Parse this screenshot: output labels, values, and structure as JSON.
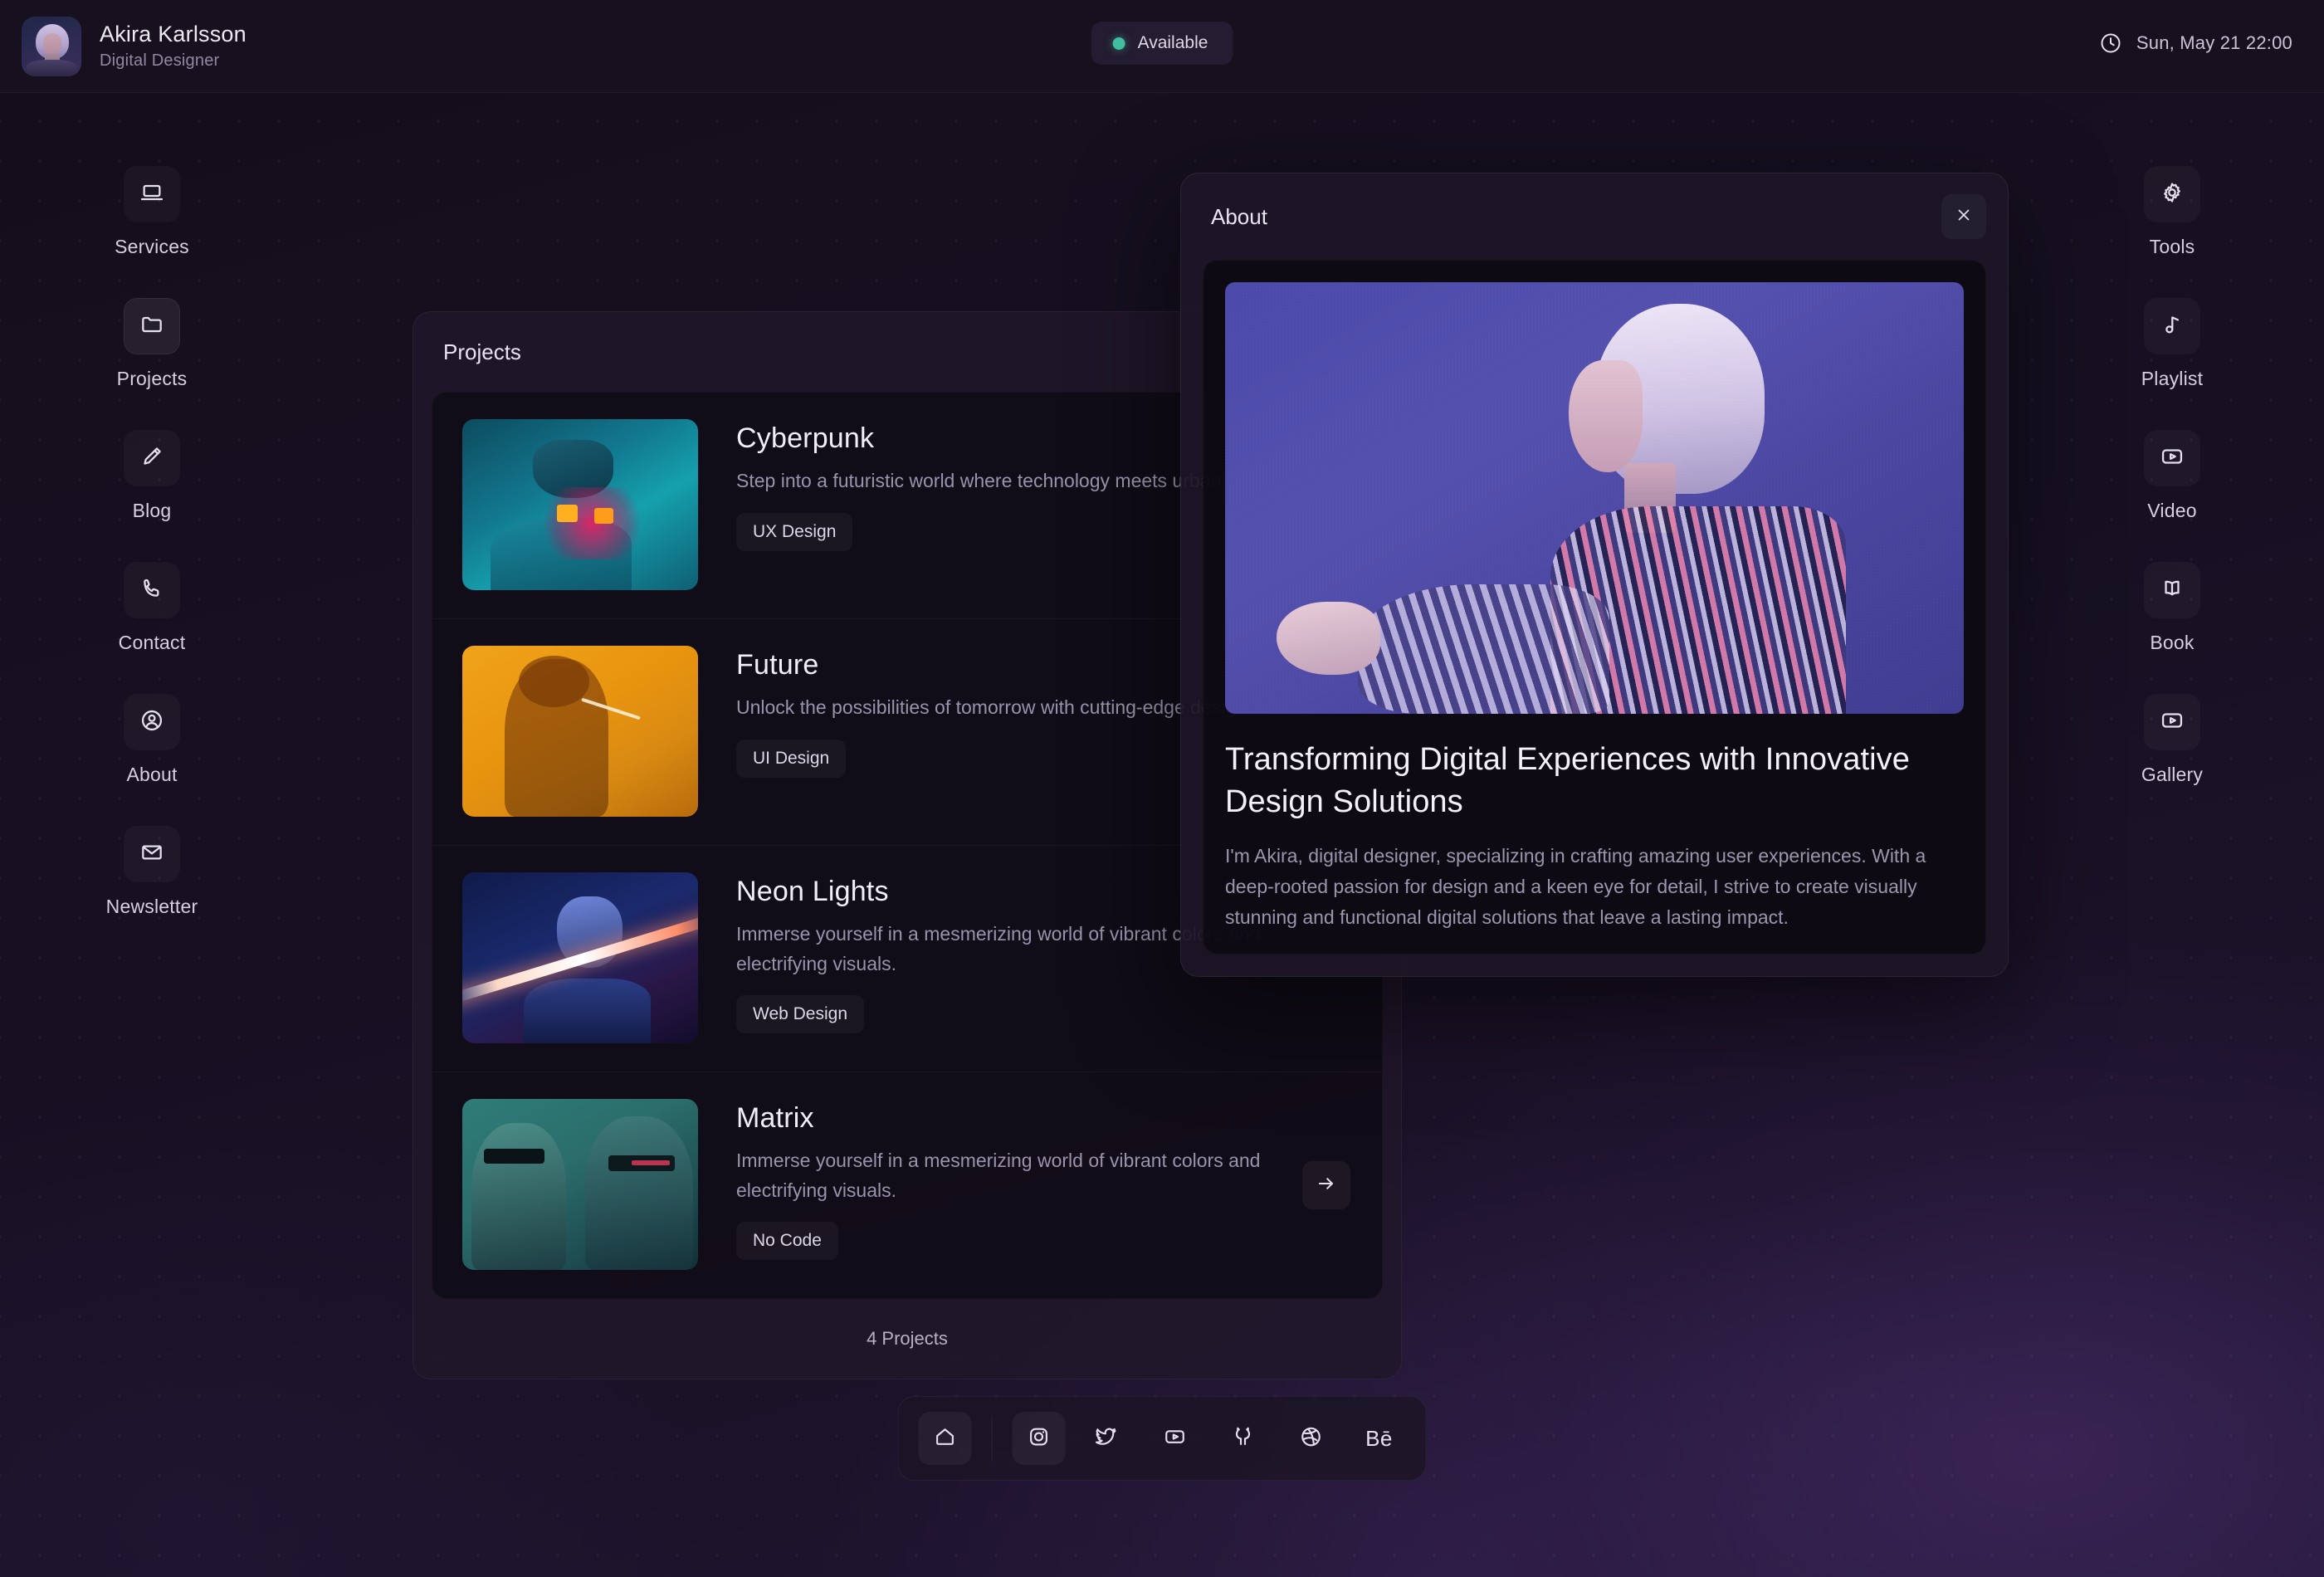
{
  "header": {
    "name": "Akira Karlsson",
    "role": "Digital Designer",
    "avatar_icon": "user-avatar-image",
    "status": {
      "label": "Available",
      "dot_color": "#3fbfa0"
    },
    "clock": {
      "icon": "clock-icon",
      "text": "Sun, May 21 22:00"
    }
  },
  "rail_left": {
    "items": [
      {
        "label": "Services",
        "icon": "laptop-icon",
        "active": false
      },
      {
        "label": "Projects",
        "icon": "folder-icon",
        "active": true
      },
      {
        "label": "Blog",
        "icon": "pencil-icon",
        "active": false
      },
      {
        "label": "Contact",
        "icon": "phone-icon",
        "active": false
      },
      {
        "label": "About",
        "icon": "user-circle-icon",
        "active": false
      },
      {
        "label": "Newsletter",
        "icon": "envelope-icon",
        "active": false
      }
    ]
  },
  "rail_right": {
    "items": [
      {
        "label": "Tools",
        "icon": "gear-icon",
        "active": false
      },
      {
        "label": "Playlist",
        "icon": "music-note-icon",
        "active": false
      },
      {
        "label": "Video",
        "icon": "video-play-icon",
        "active": false
      },
      {
        "label": "Book",
        "icon": "open-book-icon",
        "active": false
      },
      {
        "label": "Gallery",
        "icon": "video-play-icon",
        "active": false
      }
    ]
  },
  "projects_panel": {
    "title": "Projects",
    "footer": "4 Projects",
    "items": [
      {
        "title": "Cyberpunk",
        "description": "Step into a futuristic world where technology meets urban grit.",
        "tag": "UX Design",
        "thumb": "cyberpunk-thumbnail"
      },
      {
        "title": "Future",
        "description": "Unlock the possibilities of tomorrow with cutting-edge design.",
        "tag": "UI Design",
        "thumb": "future-thumbnail"
      },
      {
        "title": "Neon Lights",
        "description": "Immerse yourself in a mesmerizing world of vibrant colors and electrifying visuals.",
        "tag": "Web Design",
        "thumb": "neon-lights-thumbnail"
      },
      {
        "title": "Matrix",
        "description": "Immerse yourself in a mesmerizing world of vibrant colors and electrifying visuals.",
        "tag": "No Code",
        "thumb": "matrix-thumbnail",
        "arrow_icon": "arrow-right-icon"
      }
    ]
  },
  "about_modal": {
    "title": "About",
    "close_icon": "close-icon",
    "image": "akira-portrait-image",
    "heading": "Transforming Digital Experiences with Innovative Design Solutions",
    "body": "I'm Akira, digital designer, specializing in crafting amazing user experiences. With a deep-rooted passion for design and a keen eye for detail, I strive to create visually stunning and functional digital solutions that leave a lasting impact."
  },
  "dock": {
    "items": [
      {
        "icon": "home-icon",
        "filled": true
      },
      {
        "icon": "instagram-icon",
        "filled": true
      },
      {
        "icon": "twitter-icon",
        "filled": false
      },
      {
        "icon": "youtube-icon",
        "filled": false
      },
      {
        "icon": "github-icon",
        "filled": false
      },
      {
        "icon": "dribbble-icon",
        "filled": false
      },
      {
        "icon": "behance-icon",
        "filled": false,
        "text": "Bē"
      }
    ]
  },
  "theme": {
    "background": "#140e1b",
    "accent_purple": "#5450ae",
    "status_green": "#3fbfa0",
    "text_primary": "#f1eef7",
    "text_muted": "#9a94ab"
  }
}
